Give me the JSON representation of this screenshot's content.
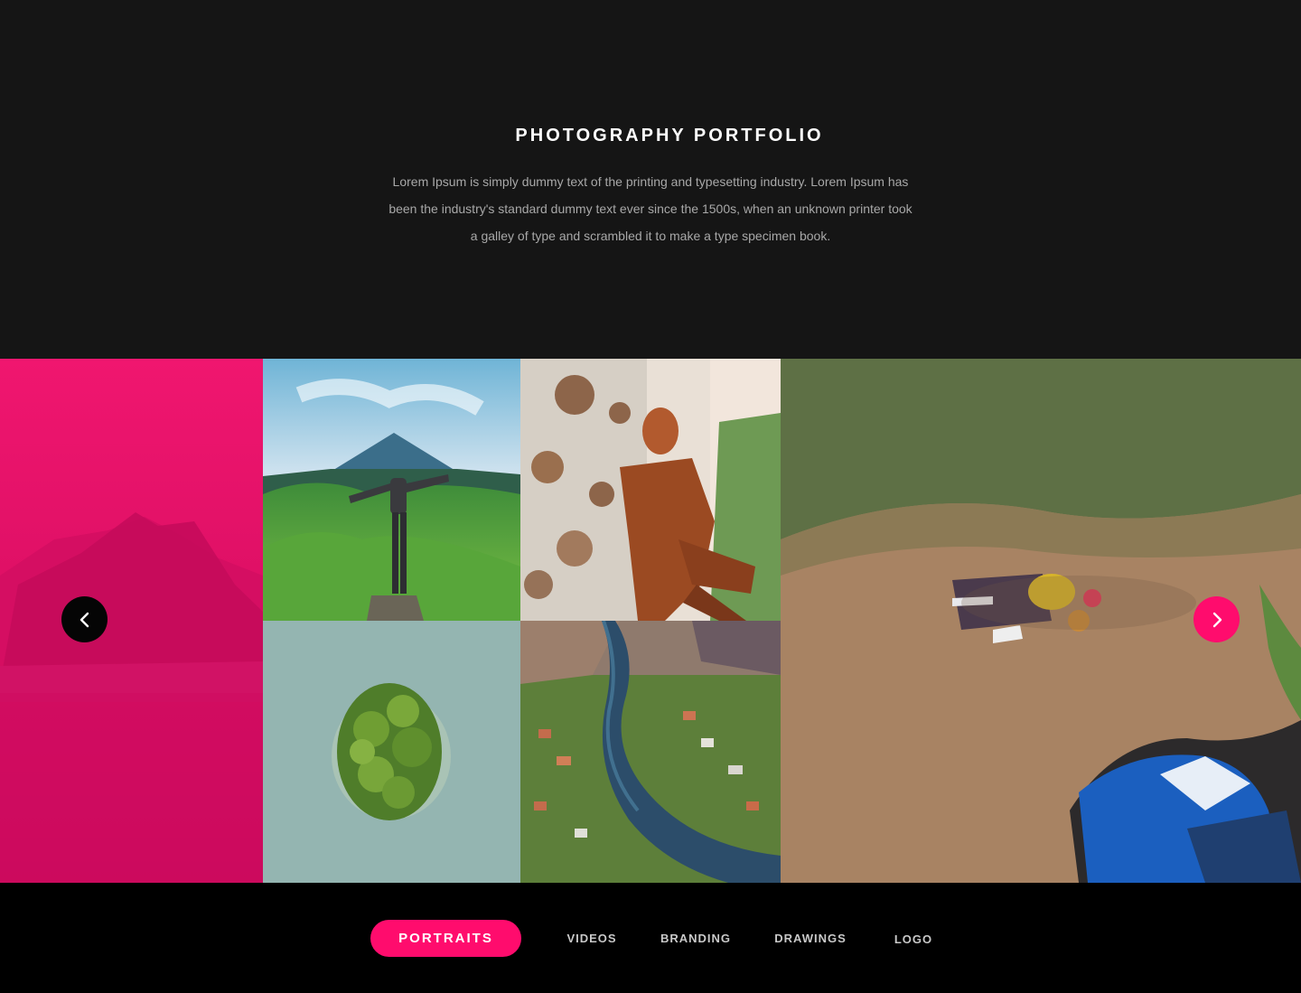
{
  "intro": {
    "title": "PHOTOGRAPHY PORTFOLIO",
    "description": "Lorem Ipsum is simply dummy text of the printing and typesetting industry. Lorem Ipsum has been the industry's standard dummy text ever since the 1500s, when an unknown printer took a galley of type and scrambled it to make a type specimen book."
  },
  "gallery": {
    "prev_icon": "chevron-left-icon",
    "next_icon": "chevron-right-icon",
    "photos": [
      "mountain-overlay-photo",
      "hiker-mountain-photo",
      "woman-rusty-wall-photo",
      "island-aerial-photo",
      "river-aerial-photo",
      "couple-car-aerial-photo"
    ]
  },
  "tabs": [
    {
      "label": "PORTRAITS",
      "active": true
    },
    {
      "label": "VIDEOS",
      "active": false
    },
    {
      "label": "BRANDING",
      "active": false
    },
    {
      "label": "DRAWINGS",
      "active": false
    },
    {
      "label": "LOGO",
      "active": false
    }
  ],
  "colors": {
    "accent": "#ff0c6d",
    "background": "#151515",
    "tab_bar": "#000000"
  }
}
